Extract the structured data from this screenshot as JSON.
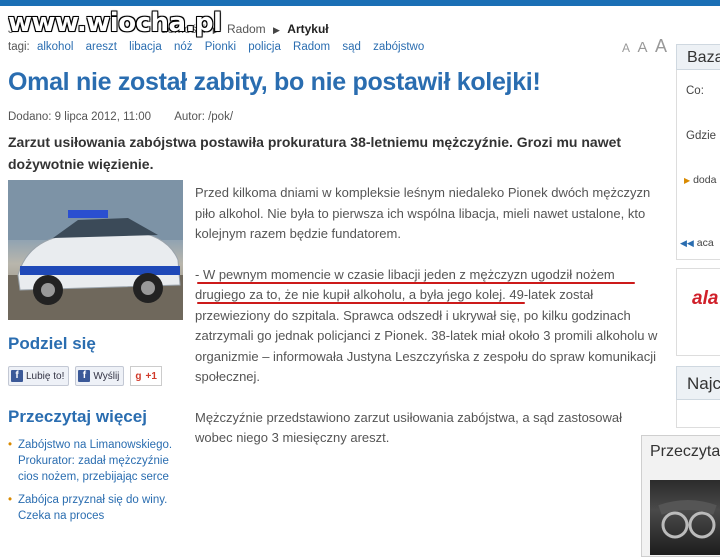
{
  "watermark": "www.wiocha.pl",
  "breadcrumb": {
    "partial": "J",
    "section_partial": "domości",
    "city": "Radom",
    "current": "Artykuł"
  },
  "tags": {
    "label": "tagi:",
    "items": [
      "alkohol",
      "areszt",
      "libacja",
      "nóż",
      "Pionki",
      "policja",
      "Radom",
      "sąd",
      "zabójstwo"
    ]
  },
  "font_size_controls": [
    "A",
    "A",
    "A"
  ],
  "article": {
    "title": "Omal nie został zabity, bo nie postawił kolejki!",
    "date": "Dodano: 9 lipca 2012, 11:00",
    "author": "Autor: /pok/",
    "lead": "Zarzut usiłowania zabójstwa postawiła prokuratura 38-letniemu mężczyźnie. Grozi mu nawet dożywotnie więzienie.",
    "paragraphs": [
      "Przed kilkoma dniami w kompleksie leśnym niedaleko Pionek dwóch mężczyzn piło alkohol. Nie była to pierwsza ich wspólna libacja, mieli nawet ustalone, kto kolejnym razem będzie fundatorem.",
      "- W pewnym momencie w czasie libacji jeden z mężczyzn ugodził nożem drugiego za to, że nie kupił alkoholu, a była jego kolej. 49-latek został przewieziony do szpitala. Sprawca odszedł i ukrywał się, po kilku godzinach zatrzymali go jednak policjanci z Pionek. 38-latek miał około 3 promili alkoholu w organizmie – informowała Justyna Leszczyńska z zespołu do spraw komunikacji społecznej.",
      "Mężczyźnie przedstawiono zarzut usiłowania zabójstwa, a sąd zastosował wobec niego 3 miesięczny areszt."
    ]
  },
  "share": {
    "title": "Podziel się",
    "like": "Lubię to!",
    "send": "Wyślij",
    "gplus": "+1"
  },
  "read_more": {
    "title": "Przeczytaj więcej",
    "items": [
      "Zabójstwo na Limanowskiego. Prokurator: zadał mężczyźnie cios nożem, przebijając serce",
      "Zabójca przyznał się do winy. Czeka na proces"
    ]
  },
  "sidebar": {
    "box1_title": "Baza",
    "co_label": "Co:",
    "gdzie_label": "Gdzie",
    "doda_label": "doda",
    "aca_label": "aca",
    "ala": "ala",
    "najc_title": "Najc",
    "popup_title": "Przeczyta"
  },
  "colors": {
    "link": "#2a6db0",
    "highlight_underline": "#cc1a1a",
    "top_bar": "#1a6fb5"
  }
}
